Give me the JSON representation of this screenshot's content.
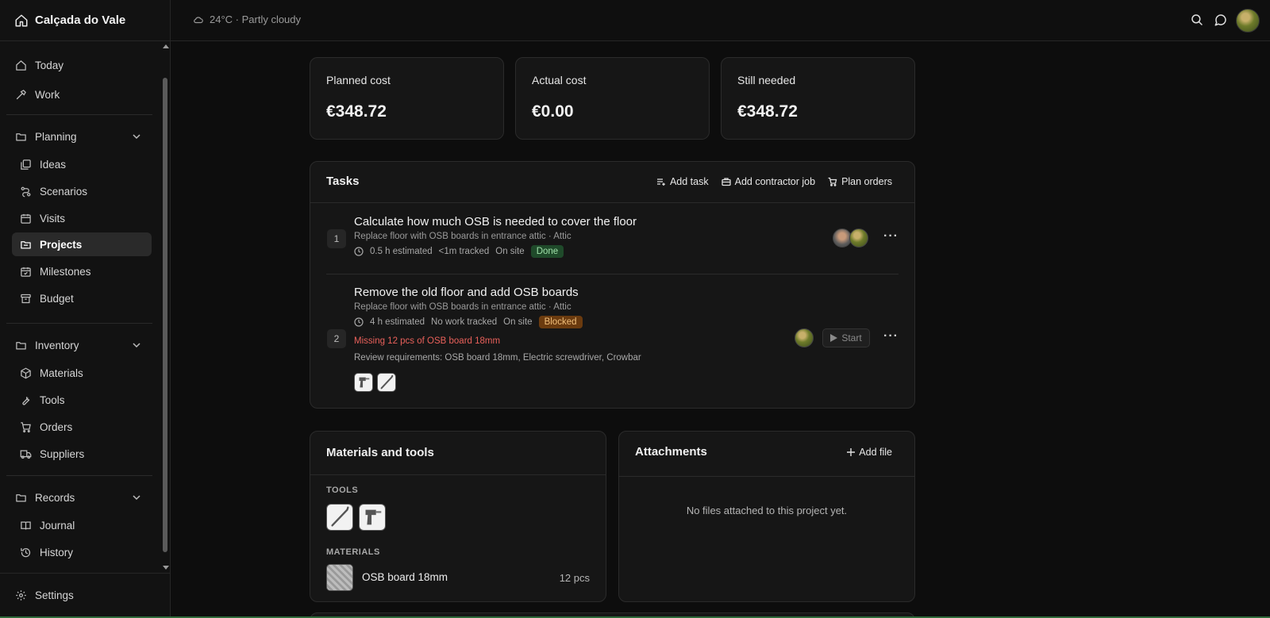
{
  "brand": {
    "name": "Calçada do Vale"
  },
  "topbar": {
    "weather": "24°C · Partly cloudy"
  },
  "sidebar": {
    "today": "Today",
    "work": "Work",
    "planning": {
      "label": "Planning",
      "items": [
        "Ideas",
        "Scenarios",
        "Visits",
        "Projects",
        "Milestones",
        "Budget"
      ],
      "active": "Projects"
    },
    "inventory": {
      "label": "Inventory",
      "items": [
        "Materials",
        "Tools",
        "Orders",
        "Suppliers"
      ]
    },
    "records": {
      "label": "Records",
      "items": [
        "Journal",
        "History"
      ]
    },
    "settings": "Settings"
  },
  "stats": [
    {
      "label": "Planned cost",
      "value": "€348.72"
    },
    {
      "label": "Actual cost",
      "value": "€0.00"
    },
    {
      "label": "Still needed",
      "value": "€348.72"
    }
  ],
  "tasks": {
    "title": "Tasks",
    "actions": {
      "add_task": "Add task",
      "add_contractor_job": "Add contractor job",
      "plan_orders": "Plan orders"
    },
    "items": [
      {
        "num": "1",
        "title": "Calculate how much OSB is needed to cover the floor",
        "subtitle": "Replace floor with OSB boards in entrance attic · Attic",
        "estimated": "0.5 h estimated",
        "tracked": "<1m tracked",
        "location": "On site",
        "status": "Done"
      },
      {
        "num": "2",
        "title": "Remove the old floor and add OSB boards",
        "subtitle": "Replace floor with OSB boards in entrance attic · Attic",
        "estimated": "4 h estimated",
        "tracked": "No work tracked",
        "location": "On site",
        "status": "Blocked",
        "missing": "Missing 12 pcs of OSB board 18mm",
        "review": "Review requirements: OSB board 18mm, Electric screwdriver, Crowbar",
        "start_label": "Start"
      }
    ]
  },
  "materials_tools": {
    "title": "Materials and tools",
    "tools_caption": "TOOLS",
    "materials_caption": "MATERIALS",
    "materials": [
      {
        "name": "OSB board 18mm",
        "qty": "12 pcs"
      }
    ]
  },
  "attachments": {
    "title": "Attachments",
    "add_file": "Add file",
    "empty": "No files attached to this project yet."
  }
}
